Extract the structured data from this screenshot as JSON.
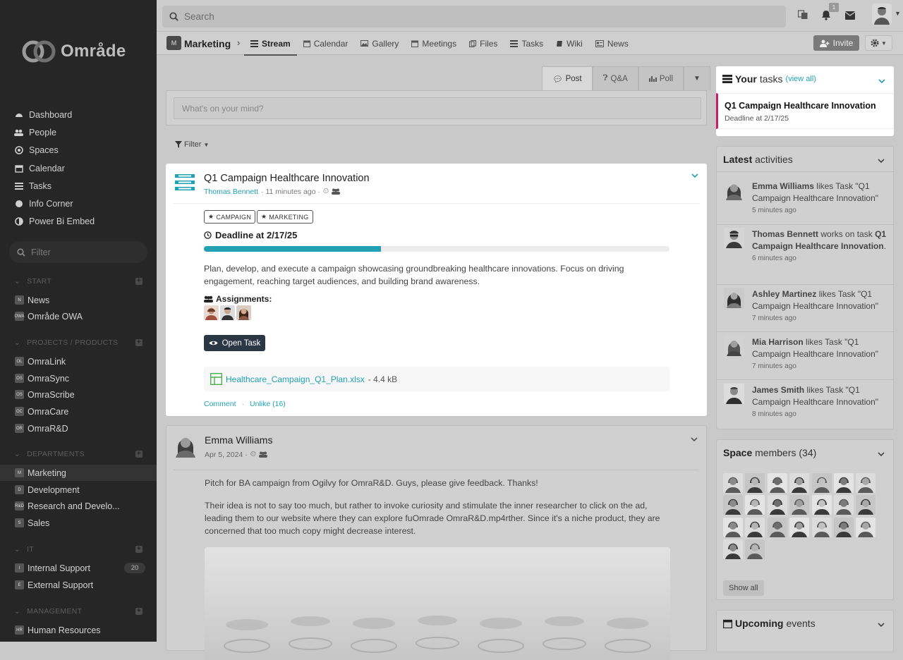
{
  "brand": {
    "name": "Område"
  },
  "sidebar": {
    "nav": [
      {
        "label": "Dashboard",
        "icon": "dashboard-icon"
      },
      {
        "label": "People",
        "icon": "people-icon"
      },
      {
        "label": "Spaces",
        "icon": "spaces-icon"
      },
      {
        "label": "Calendar",
        "icon": "calendar-icon"
      },
      {
        "label": "Tasks",
        "icon": "tasks-icon"
      },
      {
        "label": "Info Corner",
        "icon": "info-icon"
      },
      {
        "label": "Power Bi Embed",
        "icon": "chart-icon"
      }
    ],
    "filter_placeholder": "Filter",
    "sections": [
      {
        "title": "START",
        "items": [
          {
            "label": "News",
            "abbr": "N"
          },
          {
            "label": "Område OWA",
            "abbr": "OWA"
          }
        ]
      },
      {
        "title": "PROJECTS / PRODUCTS",
        "items": [
          {
            "label": "OmraLink",
            "abbr": "OL"
          },
          {
            "label": "OmraSync",
            "abbr": "OS"
          },
          {
            "label": "OmraScribe",
            "abbr": "OS"
          },
          {
            "label": "OmraCare",
            "abbr": "OC"
          },
          {
            "label": "OmraR&D",
            "abbr": "OR"
          }
        ]
      },
      {
        "title": "DEPARTMENTS",
        "items": [
          {
            "label": "Marketing",
            "abbr": "M"
          },
          {
            "label": "Development",
            "abbr": "D"
          },
          {
            "label": "Research and Develo...",
            "abbr": "R&D"
          },
          {
            "label": "Sales",
            "abbr": "S"
          }
        ]
      },
      {
        "title": "IT",
        "items": [
          {
            "label": "Internal Support",
            "abbr": "I",
            "badge": "20"
          },
          {
            "label": "External Support",
            "abbr": "E"
          }
        ]
      },
      {
        "title": "MANAGEMENT",
        "items": [
          {
            "label": "Human Resources",
            "abbr": "HR"
          }
        ]
      }
    ]
  },
  "topbar": {
    "search_placeholder": "Search",
    "notification_count": "1"
  },
  "space": {
    "avatar": "M",
    "name": "Marketing",
    "tabs": [
      "Stream",
      "Calendar",
      "Gallery",
      "Meetings",
      "Files",
      "Tasks",
      "Wiki",
      "News"
    ],
    "active_tab": "Stream",
    "invite_label": "Invite"
  },
  "composer": {
    "tabs": [
      "Post",
      "Q&A",
      "Poll"
    ],
    "placeholder": "What's on your mind?",
    "filter_label": "Filter"
  },
  "task_post": {
    "title": "Q1 Campaign Healthcare Innovation",
    "author": "Thomas Bennett",
    "time": "· 11 minutes ago ·",
    "tags": [
      "CAMPAIGN",
      "MARKETING"
    ],
    "deadline": "Deadline at 2/17/25",
    "progress": 0.38,
    "description": "Plan, develop, and execute a campaign showcasing groundbreaking healthcare innovations. Focus on driving engagement, reaching target audiences, and building brand awareness.",
    "assignments_label": "Assignments:",
    "open_label": "Open Task",
    "file_name": "Healthcare_Campaign_Q1_Plan.xlsx",
    "file_size": "- 4.4 kB",
    "comment_label": "Comment",
    "unlike_label": "Unlike (16)"
  },
  "post2": {
    "author": "Emma Williams",
    "date": "Apr 5, 2024 ·",
    "text1": "Pitch for BA campaign from Ogilvy for OmraR&D. Guys, please give feedback. Thanks!",
    "text2": "Their idea is not to say too much, but rather to invoke curiosity and stimulate the inner researcher to click on the ad, leading them to our website where they can explore fuOmrade OmraR&D.mp4rther. Since it's a niche product, they are concerned that too much copy might decrease interest."
  },
  "your_tasks": {
    "title_bold": "Your",
    "title_rest": "tasks",
    "view_all": "(view all)",
    "item_title": "Q1 Campaign Healthcare Innovation",
    "item_deadline": "Deadline at 2/17/25"
  },
  "activities": {
    "title_bold": "Latest",
    "title_rest": "activities",
    "items": [
      {
        "name": "Emma Williams",
        "text": "likes Task \"Q1 Campaign Healthcare Innovation\"",
        "time": "5 minutes ago"
      },
      {
        "name": "Thomas Bennett",
        "text": "works on task",
        "target": "Q1 Campaign Healthcare Innovation",
        "time": "6 minutes ago"
      },
      {
        "name": "Ashley Martinez",
        "text": "likes Task \"Q1 Campaign Healthcare Innovation\"",
        "time": "7 minutes ago"
      },
      {
        "name": "Mia Harrison",
        "text": "likes Task \"Q1 Campaign Healthcare Innovation\"",
        "time": "7 minutes ago"
      },
      {
        "name": "James Smith",
        "text": "likes Task \"Q1 Campaign Healthcare Innovation\"",
        "time": "8 minutes ago"
      }
    ]
  },
  "members": {
    "title_bold": "Space",
    "title_rest": "members (34)",
    "show_all": "Show all"
  },
  "events": {
    "title_bold": "Upcoming",
    "title_rest": "events"
  },
  "colors": {
    "accent": "#21a1b3",
    "task_marker": "#c81e66",
    "button_dark": "#2c3745"
  }
}
